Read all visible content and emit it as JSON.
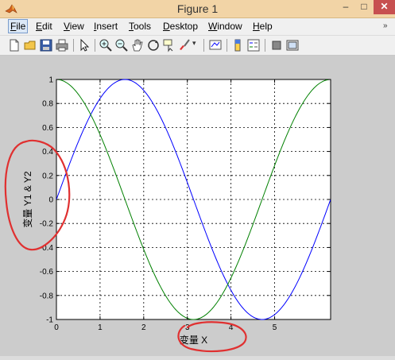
{
  "window": {
    "title": "Figure 1",
    "min_glyph": "–",
    "max_glyph": "□",
    "close_glyph": "✕"
  },
  "menu": [
    {
      "label": "File",
      "underline": "F",
      "rest": "ile",
      "name": "menu-file",
      "active": true
    },
    {
      "label": "Edit",
      "underline": "E",
      "rest": "dit",
      "name": "menu-edit"
    },
    {
      "label": "View",
      "underline": "V",
      "rest": "iew",
      "name": "menu-view"
    },
    {
      "label": "Insert",
      "underline": "I",
      "rest": "nsert",
      "name": "menu-insert"
    },
    {
      "label": "Tools",
      "underline": "T",
      "rest": "ools",
      "name": "menu-tools"
    },
    {
      "label": "Desktop",
      "underline": "D",
      "rest": "esktop",
      "name": "menu-desktop"
    },
    {
      "label": "Window",
      "underline": "W",
      "rest": "indow",
      "name": "menu-window"
    },
    {
      "label": "Help",
      "underline": "H",
      "rest": "elp",
      "name": "menu-help"
    }
  ],
  "menu_overflow": "»",
  "toolbar": [
    {
      "name": "new-figure-icon"
    },
    {
      "name": "open-file-icon"
    },
    {
      "name": "save-icon"
    },
    {
      "name": "print-icon"
    },
    {
      "name": "select-arrow-icon"
    },
    {
      "name": "zoom-in-icon"
    },
    {
      "name": "zoom-out-icon"
    },
    {
      "name": "pan-hand-icon"
    },
    {
      "name": "rotate-3d-icon"
    },
    {
      "name": "data-cursor-icon"
    },
    {
      "name": "brush-icon"
    },
    {
      "name": "link-plot-icon"
    },
    {
      "name": "colorbar-icon"
    },
    {
      "name": "legend-icon"
    },
    {
      "name": "hide-plot-tools-icon"
    },
    {
      "name": "show-plot-tools-icon"
    }
  ],
  "colors": {
    "series1": "#0000ff",
    "series2": "#008000",
    "annotation": "#e03030"
  },
  "chart_data": {
    "type": "line",
    "xlabel": "变量 X",
    "ylabel": "变量 Y1 & Y2",
    "xlim": [
      0,
      6.2832
    ],
    "ylim": [
      -1,
      1
    ],
    "xticks": [
      "0",
      "1",
      "2",
      "3",
      "4",
      "5"
    ],
    "xtick_values": [
      0,
      1,
      2,
      3,
      4,
      5
    ],
    "yticks": [
      "1",
      "0.8",
      "0.6",
      "0.4",
      "0.2",
      "0",
      "-0.2",
      "-0.4",
      "-0.6",
      "-0.8",
      "-1"
    ],
    "ytick_values": [
      1,
      0.8,
      0.6,
      0.4,
      0.2,
      0,
      -0.2,
      -0.4,
      -0.6,
      -0.8,
      -1
    ],
    "grid": true,
    "series": [
      {
        "function": "sin",
        "color": "#0000ff",
        "x": [
          0,
          0.31,
          0.63,
          0.94,
          1.26,
          1.57,
          1.88,
          2.2,
          2.51,
          2.83,
          3.14,
          3.46,
          3.77,
          4.08,
          4.4,
          4.71,
          5.03,
          5.34,
          5.65,
          5.97,
          6.28
        ],
        "y": [
          0,
          0.31,
          0.59,
          0.81,
          0.95,
          1,
          0.95,
          0.81,
          0.59,
          0.31,
          0,
          -0.31,
          -0.59,
          -0.81,
          -0.95,
          -1,
          -0.95,
          -0.81,
          -0.59,
          -0.31,
          0
        ]
      },
      {
        "function": "cos",
        "color": "#008000",
        "x": [
          0,
          0.31,
          0.63,
          0.94,
          1.26,
          1.57,
          1.88,
          2.2,
          2.51,
          2.83,
          3.14,
          3.46,
          3.77,
          4.08,
          4.4,
          4.71,
          5.03,
          5.34,
          5.65,
          5.97,
          6.28
        ],
        "y": [
          1,
          0.95,
          0.81,
          0.59,
          0.31,
          0,
          -0.31,
          -0.59,
          -0.81,
          -0.95,
          -1,
          -0.95,
          -0.81,
          -0.59,
          -0.31,
          0,
          0.31,
          0.59,
          0.81,
          0.95,
          1
        ]
      }
    ]
  }
}
